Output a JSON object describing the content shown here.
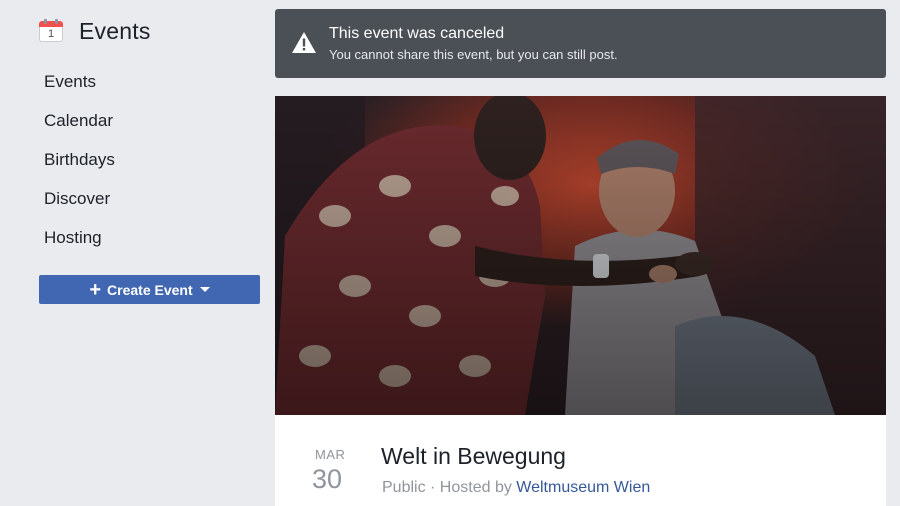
{
  "sidebar": {
    "title": "Events",
    "calendar_icon_day": "1",
    "items": [
      {
        "label": "Events"
      },
      {
        "label": "Calendar"
      },
      {
        "label": "Birthdays"
      },
      {
        "label": "Discover"
      },
      {
        "label": "Hosting"
      }
    ],
    "create_button_label": "Create Event"
  },
  "banner": {
    "title": "This event was canceled",
    "subtitle": "You cannot share this event, but you can still post.",
    "icon": "warning-icon"
  },
  "event": {
    "month": "MAR",
    "day": "30",
    "title": "Welt in Bewegung",
    "privacy": "Public",
    "separator": " · ",
    "hosted_by_label": "Hosted by ",
    "host": "Weltmuseum Wien"
  },
  "colors": {
    "accent": "#4267b2",
    "banner_bg": "#4b4f56",
    "link": "#365899",
    "muted": "#90949c"
  }
}
